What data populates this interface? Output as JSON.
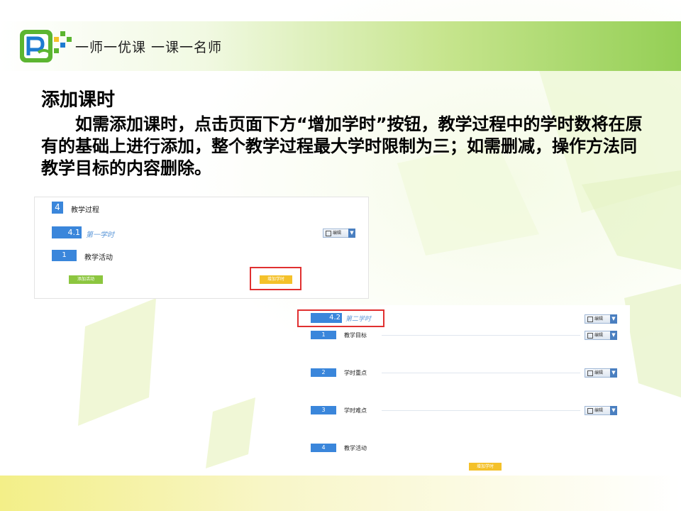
{
  "header": {
    "logo_text": "一师一优课 一课一名师",
    "colors": {
      "band_green": "#94cf55",
      "logo_green": "#5cb531",
      "logo_blue": "#1e7bd1"
    }
  },
  "slide": {
    "title": "添加课时",
    "paragraph": "如需添加课时，点击页面下方“增加学时”按钮，教学过程中的学时数将在原有的基础上进行添加，整个教学过程最大学时限制为三；如需删减，操作方法同教学目标的内容删除。"
  },
  "panel1": {
    "section_number": "4",
    "section_title": "教学过程",
    "lesson_number": "4.1",
    "lesson_title": "第一学时",
    "edit_label": "编辑",
    "activity_number": "1",
    "activity_title": "教学活动",
    "add_activity_label": "添加活动",
    "add_lesson_label": "增加学时"
  },
  "panel2": {
    "lesson_number": "4.2",
    "lesson_title": "第二学时",
    "edit_label": "编辑",
    "items": [
      {
        "number": "1",
        "title": "教学目标",
        "edit_label": "编辑"
      },
      {
        "number": "2",
        "title": "学时重点",
        "edit_label": "编辑"
      },
      {
        "number": "3",
        "title": "学时难点",
        "edit_label": "编辑"
      },
      {
        "number": "4",
        "title": "教学活动"
      }
    ],
    "add_lesson_label": "增加学时"
  },
  "colors": {
    "accent_blue": "#3a86db",
    "highlight_red": "#e03030",
    "button_yellow": "#f4c12a",
    "button_green": "#8cc63f"
  }
}
